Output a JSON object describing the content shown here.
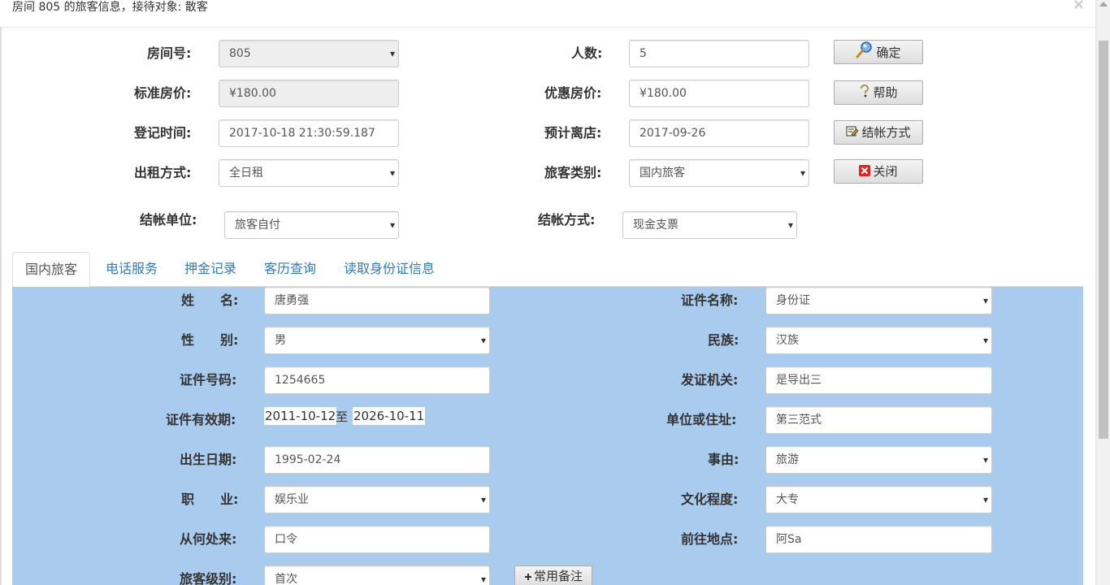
{
  "dialog": {
    "title": "房间 805 的旅客信息，接待对象: 散客",
    "close_glyph": "×"
  },
  "form": {
    "room_no": {
      "label": "房间号:",
      "value": "805"
    },
    "people": {
      "label": "人数:",
      "value": "5"
    },
    "std_price": {
      "label": "标准房价:",
      "value": "¥180.00"
    },
    "discount_price": {
      "label": "优惠房价:",
      "value": "¥180.00"
    },
    "checkin_time": {
      "label": "登记时间:",
      "value": "2017-10-18 21:30:59.187"
    },
    "checkout_date": {
      "label": "预计离店:",
      "value": "2017-09-26"
    },
    "rent_mode": {
      "label": "出租方式:",
      "value": "全日租"
    },
    "guest_type": {
      "label": "旅客类别:",
      "value": "国内旅客"
    },
    "billing_unit": {
      "label": "结帐单位:",
      "value": "旅客自付"
    },
    "payment_method": {
      "label": "结帐方式:",
      "value": "现金支票"
    }
  },
  "buttons": {
    "confirm": "确定",
    "help": "帮助",
    "billing": "结帐方式",
    "close": "关闭",
    "notes": "常用备注"
  },
  "tabs": [
    "国内旅客",
    "电话服务",
    "押金记录",
    "客历查询",
    "读取身份证信息"
  ],
  "guest": {
    "name": {
      "label": "姓　　名:",
      "value": "唐勇强"
    },
    "id_type": {
      "label": "证件名称:",
      "value": "身份证"
    },
    "gender": {
      "label": "性　　别:",
      "value": "男"
    },
    "ethnicity": {
      "label": "民族:",
      "value": "汉族"
    },
    "id_no": {
      "label": "证件号码:",
      "value": "1254665"
    },
    "issuer": {
      "label": "发证机关:",
      "value": "是导出三"
    },
    "validity": {
      "label": "证件有效期:",
      "from": "2011-10-12",
      "sep": "至",
      "to": "2026-10-11"
    },
    "address": {
      "label": "单位或住址:",
      "value": "第三范式"
    },
    "birth": {
      "label": "出生日期:",
      "value": "1995-02-24"
    },
    "reason": {
      "label": "事由:",
      "value": "旅游"
    },
    "job": {
      "label": "职　　业:",
      "value": "娱乐业"
    },
    "education": {
      "label": "文化程度:",
      "value": "大专"
    },
    "from": {
      "label": "从何处来:",
      "value": "口令"
    },
    "destination": {
      "label": "前往地点:",
      "value": "阿Sa"
    },
    "level": {
      "label": "旅客级别:",
      "value": "首次"
    }
  },
  "colors": {
    "panel": "#a9cbee",
    "tab_link": "#337ab7"
  }
}
